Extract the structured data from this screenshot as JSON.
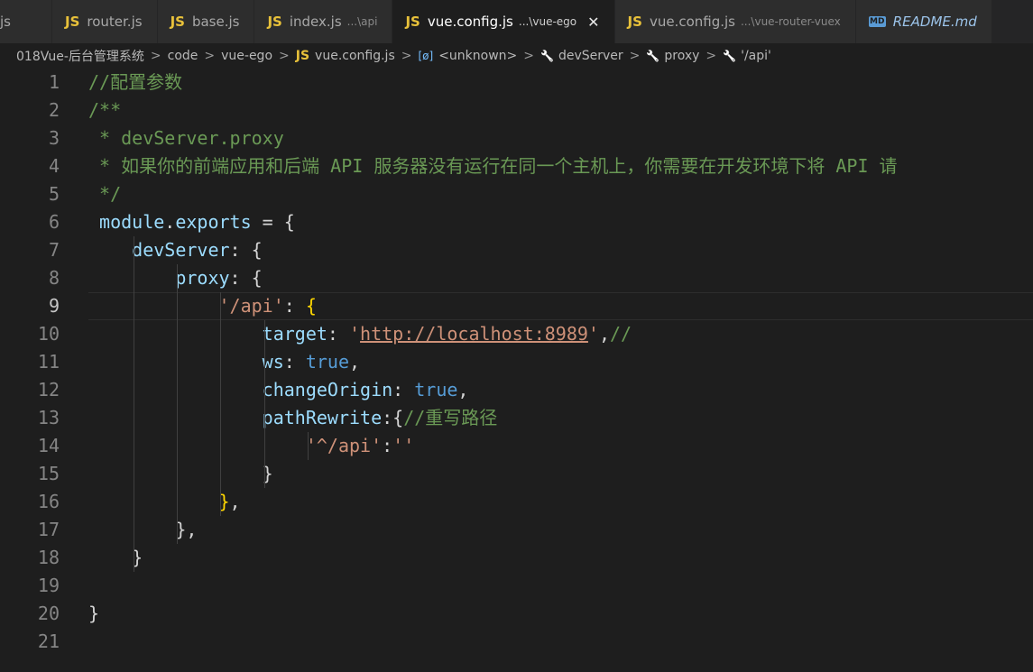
{
  "tabs": [
    {
      "icon": "",
      "label": "js",
      "desc": "",
      "active": false
    },
    {
      "icon": "JS",
      "label": "router.js",
      "desc": "",
      "active": false
    },
    {
      "icon": "JS",
      "label": "base.js",
      "desc": "",
      "active": false
    },
    {
      "icon": "JS",
      "label": "index.js",
      "desc": "...\\api",
      "active": false
    },
    {
      "icon": "JS",
      "label": "vue.config.js",
      "desc": "...\\vue-ego",
      "active": true,
      "close": "✕"
    },
    {
      "icon": "JS",
      "label": "vue.config.js",
      "desc": "...\\vue-router-vuex",
      "active": false
    },
    {
      "icon": "MD",
      "label": "README.md",
      "desc": "",
      "active": false
    }
  ],
  "breadcrumb": {
    "items": [
      "018Vue-后台管理系统",
      "code",
      "vue-ego",
      "vue.config.js",
      "<unknown>",
      "devServer",
      "proxy",
      "'/api'"
    ],
    "separator": ">"
  },
  "editor": {
    "current_line": 9,
    "line_numbers": [
      "1",
      "2",
      "3",
      "4",
      "5",
      "6",
      "7",
      "8",
      "9",
      "10",
      "11",
      "12",
      "13",
      "14",
      "15",
      "16",
      "17",
      "18",
      "19",
      "20",
      "21"
    ],
    "lines": [
      [
        {
          "t": "cm",
          "v": "//配置参数"
        }
      ],
      [
        {
          "t": "cm",
          "v": "/**"
        }
      ],
      [
        {
          "t": "cm",
          "v": " * devServer.proxy"
        }
      ],
      [
        {
          "t": "cm",
          "v": " * 如果你的前端应用和后端 API 服务器没有运行在同一个主机上，你需要在开发环境下将 API 请"
        }
      ],
      [
        {
          "t": "cm",
          "v": " */"
        }
      ],
      [
        {
          "t": "vr",
          "v": " module"
        },
        {
          "t": "pn",
          "v": "."
        },
        {
          "t": "vr",
          "v": "exports"
        },
        {
          "t": "pn",
          "v": " = {"
        }
      ],
      [
        {
          "t": "pn",
          "v": "    "
        },
        {
          "t": "vr",
          "v": "devServer"
        },
        {
          "t": "pn",
          "v": ": {"
        }
      ],
      [
        {
          "t": "pn",
          "v": "        "
        },
        {
          "t": "vr",
          "v": "proxy"
        },
        {
          "t": "pn",
          "v": ": {"
        }
      ],
      [
        {
          "t": "pn",
          "v": "            "
        },
        {
          "t": "str",
          "v": "'/api'"
        },
        {
          "t": "pn",
          "v": ": "
        },
        {
          "t": "br",
          "v": "{"
        }
      ],
      [
        {
          "t": "pn",
          "v": "                "
        },
        {
          "t": "vr",
          "v": "target"
        },
        {
          "t": "pn",
          "v": ": "
        },
        {
          "t": "str",
          "v": "'"
        },
        {
          "t": "url",
          "v": "http://localhost:8989"
        },
        {
          "t": "str",
          "v": "'"
        },
        {
          "t": "pn",
          "v": ","
        },
        {
          "t": "cm",
          "v": "//"
        }
      ],
      [
        {
          "t": "pn",
          "v": "                "
        },
        {
          "t": "vr",
          "v": "ws"
        },
        {
          "t": "pn",
          "v": ": "
        },
        {
          "t": "kw",
          "v": "true"
        },
        {
          "t": "pn",
          "v": ","
        }
      ],
      [
        {
          "t": "pn",
          "v": "                "
        },
        {
          "t": "vr",
          "v": "changeOrigin"
        },
        {
          "t": "pn",
          "v": ": "
        },
        {
          "t": "kw",
          "v": "true"
        },
        {
          "t": "pn",
          "v": ","
        }
      ],
      [
        {
          "t": "pn",
          "v": "                "
        },
        {
          "t": "vr",
          "v": "pathRewrite"
        },
        {
          "t": "pn",
          "v": ":{"
        },
        {
          "t": "cm",
          "v": "//重写路径"
        }
      ],
      [
        {
          "t": "pn",
          "v": "                    "
        },
        {
          "t": "str",
          "v": "'^/api'"
        },
        {
          "t": "pn",
          "v": ":"
        },
        {
          "t": "str",
          "v": "''"
        }
      ],
      [
        {
          "t": "pn",
          "v": "                }"
        }
      ],
      [
        {
          "t": "pn",
          "v": "            "
        },
        {
          "t": "br",
          "v": "}"
        },
        {
          "t": "pn",
          "v": ","
        }
      ],
      [
        {
          "t": "pn",
          "v": "        },"
        }
      ],
      [
        {
          "t": "pn",
          "v": "    }"
        }
      ],
      [
        {
          "t": "pn",
          "v": ""
        }
      ],
      [
        {
          "t": "pn",
          "v": "}"
        }
      ],
      [
        {
          "t": "pn",
          "v": ""
        }
      ]
    ]
  },
  "colors": {
    "background": "#1e1e1e",
    "tab_active": "#1e1e1e",
    "tab_inactive": "#2d2d2d",
    "comment": "#6a9955",
    "keyword": "#569cd6",
    "variable": "#9cdcfe",
    "string": "#ce9178",
    "bracket_match": "#ffd700",
    "js_icon": "#e8c13a"
  },
  "icons": {
    "breadcrumb_js": "JS",
    "breadcrumb_var": "[ø]",
    "breadcrumb_wrench": "🔧"
  }
}
